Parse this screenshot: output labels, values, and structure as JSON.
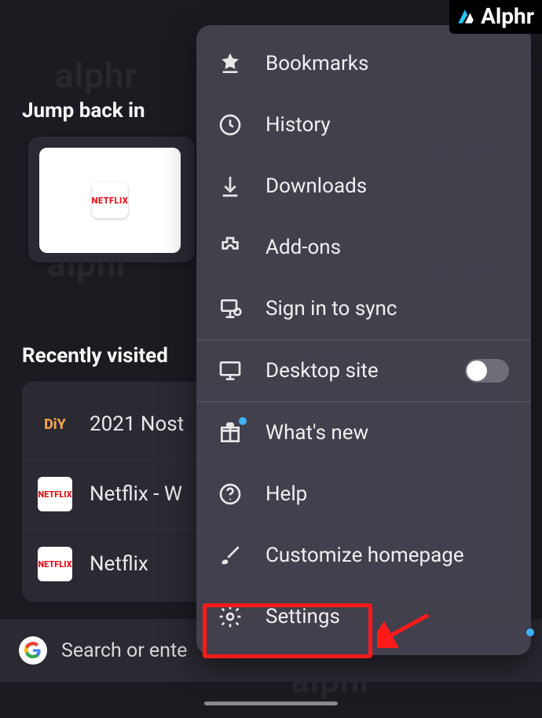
{
  "brand": {
    "name": "Alphr"
  },
  "sections": {
    "jump_back": "Jump back in",
    "recently_visited": "Recently visited"
  },
  "jump_back_tile": {
    "label": "NETFLIX"
  },
  "recent_items": [
    {
      "icon_text": "DiY",
      "title": "2021 Nost",
      "icon_class": "diy"
    },
    {
      "icon_text": "NETFLIX",
      "title": "Netflix - W",
      "icon_class": "nflx"
    },
    {
      "icon_text": "NETFLIX",
      "title": "Netflix",
      "icon_class": "nflx"
    }
  ],
  "search": {
    "placeholder": "Search or enter address",
    "visible_text": "Search or ente"
  },
  "menu": {
    "bookmarks": "Bookmarks",
    "history": "History",
    "downloads": "Downloads",
    "addons": "Add-ons",
    "sign_in": "Sign in to sync",
    "desktop_site": "Desktop site",
    "whats_new": "What's new",
    "help": "Help",
    "customize": "Customize homepage",
    "settings": "Settings"
  },
  "desktop_toggle_on": false
}
